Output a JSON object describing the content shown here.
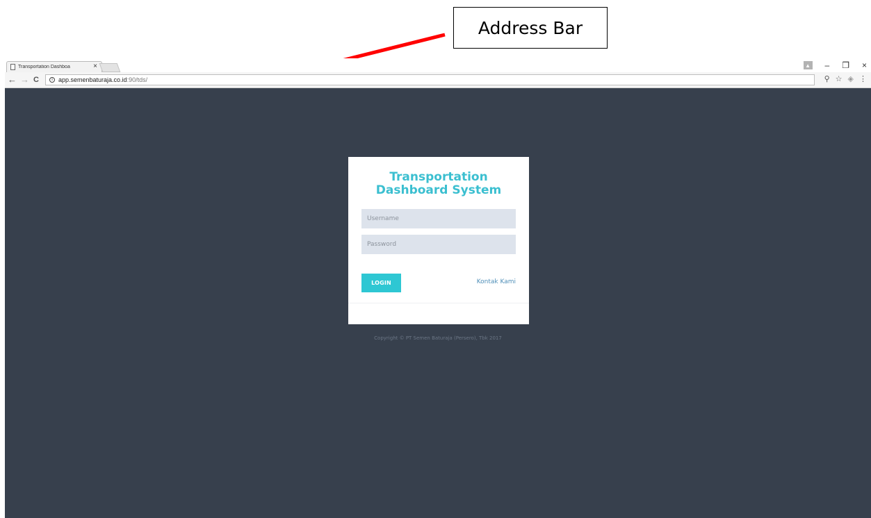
{
  "annotation": {
    "label": "Address Bar",
    "arrow_color": "#ff0000"
  },
  "browser": {
    "tab_title": "Transportation Dashboa",
    "tab_close": "×",
    "window_controls": {
      "minimize": "–",
      "restore": "❐",
      "close": "×",
      "profile": "▲"
    },
    "nav": {
      "back": "←",
      "forward": "→",
      "reload": "C"
    },
    "url_host": "app.semenbaturaja.co.id",
    "url_path": ":90/tds/",
    "info_glyph": "i",
    "tools": {
      "key": "⚲",
      "star": "☆",
      "extension": "◈",
      "menu": "⋮"
    }
  },
  "login": {
    "title_line1": "Transportation",
    "title_line2": "Dashboard System",
    "username_placeholder": "Username",
    "password_placeholder": "Password",
    "login_label": "LOGIN",
    "contact_label": "Kontak Kami",
    "copyright": "Copyright © PT Semen Baturaja (Persero), Tbk 2017"
  },
  "colors": {
    "page_background": "#37404d",
    "title": "#3bbfd0",
    "button": "#2ec7d3",
    "link": "#4f8fb8",
    "input_background": "#dde3ec"
  }
}
